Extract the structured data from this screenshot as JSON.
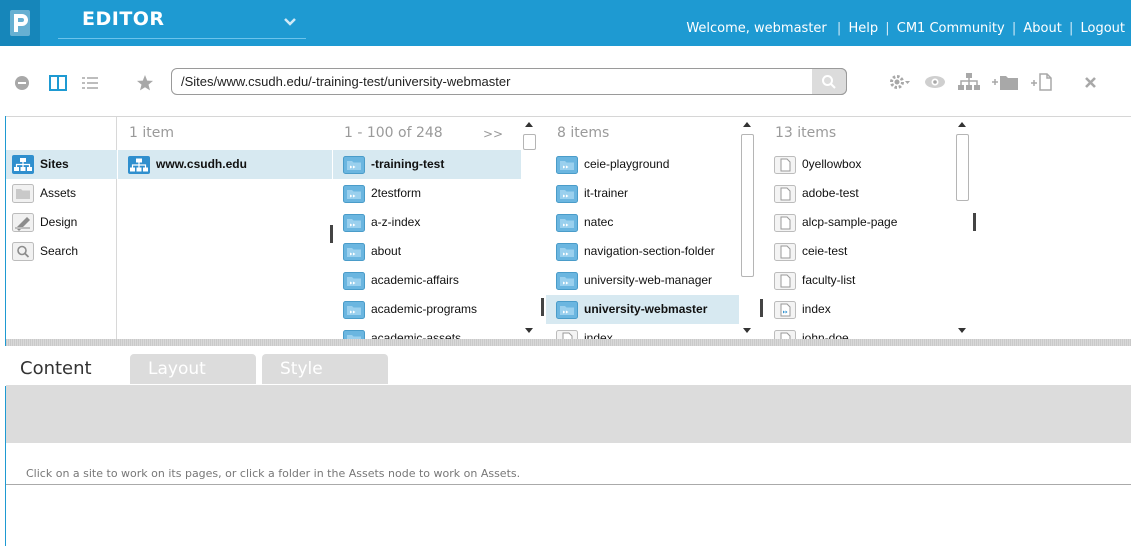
{
  "header": {
    "app_title": "EDITOR",
    "nav": {
      "welcome": "Welcome, webmaster",
      "help": "Help",
      "community": "CM1 Community",
      "about": "About",
      "logout": "Logout",
      "separator": "|"
    }
  },
  "toolbar": {
    "path_value": "/Sites/www.csudh.edu/-training-test/university-webmaster",
    "icons_left": [
      "minus-circle-icon",
      "columns-view-icon",
      "list-view-icon",
      "star-icon"
    ],
    "icons_right": [
      "gear-icon",
      "eye-icon",
      "sitemap-icon",
      "add-folder-icon",
      "add-page-icon",
      "close-icon"
    ]
  },
  "nav": {
    "items": [
      {
        "label": "Sites",
        "icon": "sites-icon",
        "selected": true
      },
      {
        "label": "Assets",
        "icon": "assets-icon",
        "selected": false
      },
      {
        "label": "Design",
        "icon": "design-icon",
        "selected": false
      },
      {
        "label": "Search",
        "icon": "search-icon",
        "selected": false
      }
    ]
  },
  "columns": [
    {
      "header": "1 item",
      "more": "",
      "items": [
        {
          "label": "www.csudh.edu",
          "icon": "site-icon",
          "selected": true
        }
      ]
    },
    {
      "header": "1 - 100 of 248",
      "more": ">>",
      "items": [
        {
          "label": "-training-test",
          "icon": "folder-icon",
          "selected": true
        },
        {
          "label": "2testform",
          "icon": "folder-icon",
          "selected": false
        },
        {
          "label": "a-z-index",
          "icon": "folder-icon",
          "selected": false
        },
        {
          "label": "about",
          "icon": "folder-icon",
          "selected": false
        },
        {
          "label": "academic-affairs",
          "icon": "folder-icon",
          "selected": false
        },
        {
          "label": "academic-programs",
          "icon": "folder-icon",
          "selected": false
        },
        {
          "label": "academic-assets",
          "icon": "folder-icon",
          "selected": false
        }
      ]
    },
    {
      "header": "8 items",
      "more": "",
      "items": [
        {
          "label": "ceie-playground",
          "icon": "folder-icon",
          "selected": false
        },
        {
          "label": "it-trainer",
          "icon": "folder-icon",
          "selected": false
        },
        {
          "label": "natec",
          "icon": "folder-icon",
          "selected": false
        },
        {
          "label": "navigation-section-folder",
          "icon": "folder-icon",
          "selected": false
        },
        {
          "label": "university-web-manager",
          "icon": "folder-icon",
          "selected": false
        },
        {
          "label": "university-webmaster",
          "icon": "folder-icon",
          "selected": true
        },
        {
          "label": "index",
          "icon": "page-icon",
          "selected": false
        }
      ]
    },
    {
      "header": "13 items",
      "more": "",
      "items": [
        {
          "label": "0yellowbox",
          "icon": "page-icon",
          "selected": false
        },
        {
          "label": "adobe-test",
          "icon": "page-icon",
          "selected": false
        },
        {
          "label": "alcp-sample-page",
          "icon": "page-icon",
          "selected": false
        },
        {
          "label": "ceie-test",
          "icon": "page-icon",
          "selected": false
        },
        {
          "label": "faculty-list",
          "icon": "page-icon",
          "selected": false
        },
        {
          "label": "index",
          "icon": "page-link-icon",
          "selected": false
        },
        {
          "label": "john-doe",
          "icon": "page-icon",
          "selected": false
        }
      ]
    }
  ],
  "tabs": [
    {
      "label": "Content",
      "active": true
    },
    {
      "label": "Layout",
      "active": false
    },
    {
      "label": "Style",
      "active": false
    }
  ],
  "status": {
    "message": "Click on a site to work on its pages, or click a folder in the Assets node to work on Assets."
  },
  "colors": {
    "header_bg": "#1e9ad2",
    "selection_bg": "#d7e9f1",
    "folder_blue": "#6bb6e0",
    "tab_inactive": "#dcdcdc"
  }
}
